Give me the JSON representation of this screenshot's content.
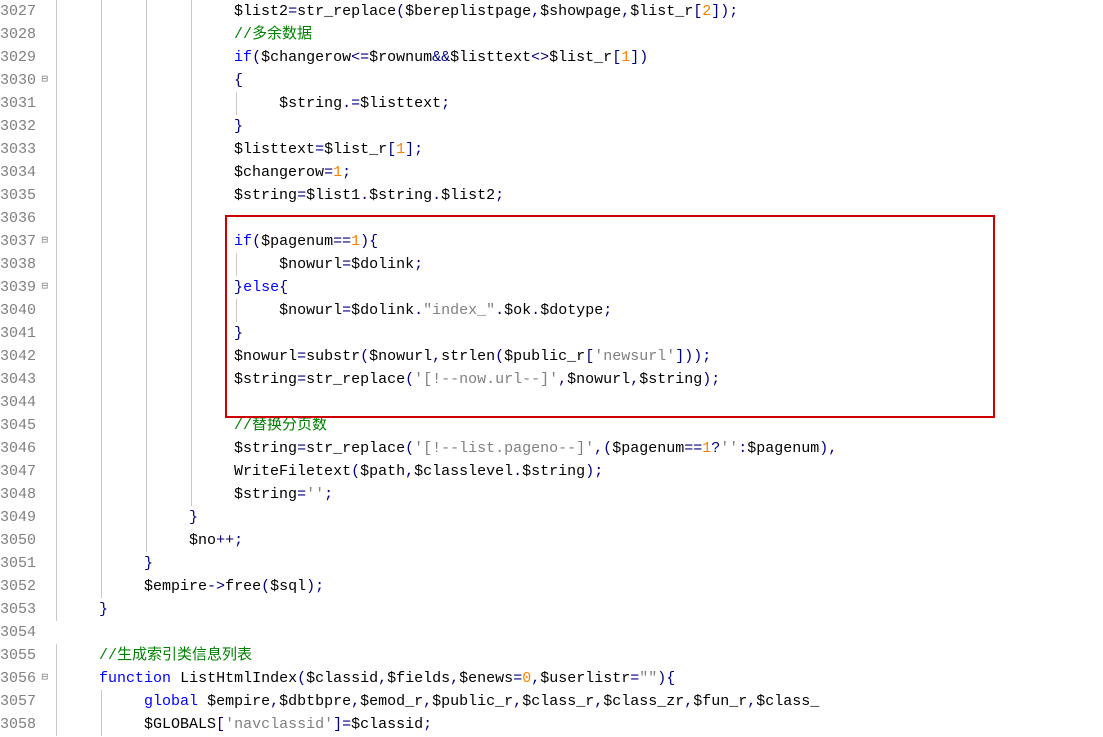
{
  "lines": [
    {
      "num": "3027",
      "fold": "",
      "indent": 4,
      "tokens": [
        {
          "t": "v",
          "v": "$list2"
        },
        {
          "t": "o",
          "v": "="
        },
        {
          "t": "fc",
          "v": "str_replace"
        },
        {
          "t": "p",
          "v": "("
        },
        {
          "t": "v",
          "v": "$bereplistpage"
        },
        {
          "t": "p",
          "v": ","
        },
        {
          "t": "v",
          "v": "$showpage"
        },
        {
          "t": "p",
          "v": ","
        },
        {
          "t": "v",
          "v": "$list_r"
        },
        {
          "t": "br",
          "v": "["
        },
        {
          "t": "n",
          "v": "2"
        },
        {
          "t": "br",
          "v": "]"
        },
        {
          "t": "p",
          "v": ")"
        },
        {
          "t": "s",
          "v": ";"
        }
      ]
    },
    {
      "num": "3028",
      "fold": "",
      "indent": 4,
      "tokens": [
        {
          "t": "c",
          "v": "//多余数据"
        }
      ]
    },
    {
      "num": "3029",
      "fold": "",
      "indent": 4,
      "tokens": [
        {
          "t": "k",
          "v": "if"
        },
        {
          "t": "p",
          "v": "("
        },
        {
          "t": "v",
          "v": "$changerow"
        },
        {
          "t": "o",
          "v": "<="
        },
        {
          "t": "v",
          "v": "$rownum"
        },
        {
          "t": "o",
          "v": "&&"
        },
        {
          "t": "v",
          "v": "$listtext"
        },
        {
          "t": "o",
          "v": "<>"
        },
        {
          "t": "v",
          "v": "$list_r"
        },
        {
          "t": "br",
          "v": "["
        },
        {
          "t": "n",
          "v": "1"
        },
        {
          "t": "br",
          "v": "]"
        },
        {
          "t": "p",
          "v": ")"
        }
      ]
    },
    {
      "num": "3030",
      "fold": "⊟",
      "indent": 4,
      "tokens": [
        {
          "t": "b",
          "v": "{"
        }
      ]
    },
    {
      "num": "3031",
      "fold": "",
      "indent": 5,
      "tokens": [
        {
          "t": "v",
          "v": "$string"
        },
        {
          "t": "o",
          "v": ".="
        },
        {
          "t": "v",
          "v": "$listtext"
        },
        {
          "t": "s",
          "v": ";"
        }
      ]
    },
    {
      "num": "3032",
      "fold": "",
      "indent": 4,
      "tokens": [
        {
          "t": "b",
          "v": "}"
        }
      ]
    },
    {
      "num": "3033",
      "fold": "",
      "indent": 4,
      "tokens": [
        {
          "t": "v",
          "v": "$listtext"
        },
        {
          "t": "o",
          "v": "="
        },
        {
          "t": "v",
          "v": "$list_r"
        },
        {
          "t": "br",
          "v": "["
        },
        {
          "t": "n",
          "v": "1"
        },
        {
          "t": "br",
          "v": "]"
        },
        {
          "t": "s",
          "v": ";"
        }
      ]
    },
    {
      "num": "3034",
      "fold": "",
      "indent": 4,
      "tokens": [
        {
          "t": "v",
          "v": "$changerow"
        },
        {
          "t": "o",
          "v": "="
        },
        {
          "t": "n",
          "v": "1"
        },
        {
          "t": "s",
          "v": ";"
        }
      ]
    },
    {
      "num": "3035",
      "fold": "",
      "indent": 4,
      "tokens": [
        {
          "t": "v",
          "v": "$string"
        },
        {
          "t": "o",
          "v": "="
        },
        {
          "t": "v",
          "v": "$list1"
        },
        {
          "t": "d",
          "v": "."
        },
        {
          "t": "v",
          "v": "$string"
        },
        {
          "t": "d",
          "v": "."
        },
        {
          "t": "v",
          "v": "$list2"
        },
        {
          "t": "s",
          "v": ";"
        }
      ]
    },
    {
      "num": "3036",
      "fold": "",
      "indent": 4,
      "tokens": []
    },
    {
      "num": "3037",
      "fold": "⊟",
      "indent": 4,
      "tokens": [
        {
          "t": "k",
          "v": "if"
        },
        {
          "t": "p",
          "v": "("
        },
        {
          "t": "v",
          "v": "$pagenum"
        },
        {
          "t": "o",
          "v": "=="
        },
        {
          "t": "n",
          "v": "1"
        },
        {
          "t": "p",
          "v": ")"
        },
        {
          "t": "b",
          "v": "{"
        }
      ]
    },
    {
      "num": "3038",
      "fold": "",
      "indent": 5,
      "tokens": [
        {
          "t": "v",
          "v": "$nowurl"
        },
        {
          "t": "o",
          "v": "="
        },
        {
          "t": "v",
          "v": "$dolink"
        },
        {
          "t": "s",
          "v": ";"
        }
      ]
    },
    {
      "num": "3039",
      "fold": "⊟",
      "indent": 4,
      "tokens": [
        {
          "t": "b",
          "v": "}"
        },
        {
          "t": "k",
          "v": "else"
        },
        {
          "t": "b",
          "v": "{"
        }
      ]
    },
    {
      "num": "3040",
      "fold": "",
      "indent": 5,
      "tokens": [
        {
          "t": "v",
          "v": "$nowurl"
        },
        {
          "t": "o",
          "v": "="
        },
        {
          "t": "v",
          "v": "$dolink"
        },
        {
          "t": "d",
          "v": "."
        },
        {
          "t": "st",
          "v": "\"index_\""
        },
        {
          "t": "d",
          "v": "."
        },
        {
          "t": "v",
          "v": "$ok"
        },
        {
          "t": "d",
          "v": "."
        },
        {
          "t": "v",
          "v": "$dotype"
        },
        {
          "t": "s",
          "v": ";"
        }
      ]
    },
    {
      "num": "3041",
      "fold": "",
      "indent": 4,
      "tokens": [
        {
          "t": "b",
          "v": "}"
        }
      ]
    },
    {
      "num": "3042",
      "fold": "",
      "indent": 4,
      "tokens": [
        {
          "t": "v",
          "v": "$nowurl"
        },
        {
          "t": "o",
          "v": "="
        },
        {
          "t": "fc",
          "v": "substr"
        },
        {
          "t": "p",
          "v": "("
        },
        {
          "t": "v",
          "v": "$nowurl"
        },
        {
          "t": "p",
          "v": ","
        },
        {
          "t": "fc",
          "v": "strlen"
        },
        {
          "t": "p",
          "v": "("
        },
        {
          "t": "v",
          "v": "$public_r"
        },
        {
          "t": "br",
          "v": "["
        },
        {
          "t": "st",
          "v": "'newsurl'"
        },
        {
          "t": "br",
          "v": "]"
        },
        {
          "t": "p",
          "v": ")"
        },
        {
          "t": "p",
          "v": ")"
        },
        {
          "t": "s",
          "v": ";"
        }
      ]
    },
    {
      "num": "3043",
      "fold": "",
      "indent": 4,
      "tokens": [
        {
          "t": "v",
          "v": "$string"
        },
        {
          "t": "o",
          "v": "="
        },
        {
          "t": "fc",
          "v": "str_replace"
        },
        {
          "t": "p",
          "v": "("
        },
        {
          "t": "st",
          "v": "'[!--now.url--]'"
        },
        {
          "t": "p",
          "v": ","
        },
        {
          "t": "v",
          "v": "$nowurl"
        },
        {
          "t": "p",
          "v": ","
        },
        {
          "t": "v",
          "v": "$string"
        },
        {
          "t": "p",
          "v": ")"
        },
        {
          "t": "s",
          "v": ";"
        }
      ]
    },
    {
      "num": "3044",
      "fold": "",
      "indent": 4,
      "tokens": []
    },
    {
      "num": "3045",
      "fold": "",
      "indent": 4,
      "tokens": [
        {
          "t": "c",
          "v": "//替换分页数"
        }
      ]
    },
    {
      "num": "3046",
      "fold": "",
      "indent": 4,
      "tokens": [
        {
          "t": "v",
          "v": "$string"
        },
        {
          "t": "o",
          "v": "="
        },
        {
          "t": "fc",
          "v": "str_replace"
        },
        {
          "t": "p",
          "v": "("
        },
        {
          "t": "st",
          "v": "'[!--list.pageno--]'"
        },
        {
          "t": "p",
          "v": ","
        },
        {
          "t": "p",
          "v": "("
        },
        {
          "t": "v",
          "v": "$pagenum"
        },
        {
          "t": "o",
          "v": "=="
        },
        {
          "t": "n",
          "v": "1"
        },
        {
          "t": "o",
          "v": "?"
        },
        {
          "t": "st",
          "v": "''"
        },
        {
          "t": "o",
          "v": ":"
        },
        {
          "t": "v",
          "v": "$pagenum"
        },
        {
          "t": "p",
          "v": ")"
        },
        {
          "t": "p",
          "v": ","
        }
      ]
    },
    {
      "num": "3047",
      "fold": "",
      "indent": 4,
      "tokens": [
        {
          "t": "fc",
          "v": "WriteFiletext"
        },
        {
          "t": "p",
          "v": "("
        },
        {
          "t": "v",
          "v": "$path"
        },
        {
          "t": "p",
          "v": ","
        },
        {
          "t": "v",
          "v": "$classlevel"
        },
        {
          "t": "d",
          "v": "."
        },
        {
          "t": "v",
          "v": "$string"
        },
        {
          "t": "p",
          "v": ")"
        },
        {
          "t": "s",
          "v": ";"
        }
      ]
    },
    {
      "num": "3048",
      "fold": "",
      "indent": 4,
      "tokens": [
        {
          "t": "v",
          "v": "$string"
        },
        {
          "t": "o",
          "v": "="
        },
        {
          "t": "st",
          "v": "''"
        },
        {
          "t": "s",
          "v": ";"
        }
      ]
    },
    {
      "num": "3049",
      "fold": "",
      "indent": 3,
      "tokens": [
        {
          "t": "b",
          "v": "}"
        }
      ]
    },
    {
      "num": "3050",
      "fold": "",
      "indent": 3,
      "tokens": [
        {
          "t": "v",
          "v": "$no"
        },
        {
          "t": "o",
          "v": "++"
        },
        {
          "t": "s",
          "v": ";"
        }
      ]
    },
    {
      "num": "3051",
      "fold": "",
      "indent": 2,
      "tokens": [
        {
          "t": "b",
          "v": "}"
        }
      ]
    },
    {
      "num": "3052",
      "fold": "",
      "indent": 2,
      "tokens": [
        {
          "t": "v",
          "v": "$empire"
        },
        {
          "t": "a",
          "v": "->"
        },
        {
          "t": "fc",
          "v": "free"
        },
        {
          "t": "p",
          "v": "("
        },
        {
          "t": "v",
          "v": "$sql"
        },
        {
          "t": "p",
          "v": ")"
        },
        {
          "t": "s",
          "v": ";"
        }
      ]
    },
    {
      "num": "3053",
      "fold": "",
      "indent": 1,
      "tokens": [
        {
          "t": "b",
          "v": "}"
        }
      ]
    },
    {
      "num": "3054",
      "fold": "",
      "indent": 0,
      "tokens": []
    },
    {
      "num": "3055",
      "fold": "",
      "indent": 1,
      "tokens": [
        {
          "t": "c",
          "v": "//生成索引类信息列表"
        }
      ]
    },
    {
      "num": "3056",
      "fold": "⊟",
      "indent": 1,
      "tokens": [
        {
          "t": "k",
          "v": "function"
        },
        {
          "t": "sp",
          "v": " "
        },
        {
          "t": "fc",
          "v": "ListHtmlIndex"
        },
        {
          "t": "p",
          "v": "("
        },
        {
          "t": "v",
          "v": "$classid"
        },
        {
          "t": "p",
          "v": ","
        },
        {
          "t": "v",
          "v": "$fields"
        },
        {
          "t": "p",
          "v": ","
        },
        {
          "t": "v",
          "v": "$enews"
        },
        {
          "t": "o",
          "v": "="
        },
        {
          "t": "n",
          "v": "0"
        },
        {
          "t": "p",
          "v": ","
        },
        {
          "t": "v",
          "v": "$userlistr"
        },
        {
          "t": "o",
          "v": "="
        },
        {
          "t": "st",
          "v": "\"\""
        },
        {
          "t": "p",
          "v": ")"
        },
        {
          "t": "b",
          "v": "{"
        }
      ]
    },
    {
      "num": "3057",
      "fold": "",
      "indent": 2,
      "tokens": [
        {
          "t": "k",
          "v": "global"
        },
        {
          "t": "sp",
          "v": " "
        },
        {
          "t": "v",
          "v": "$empire"
        },
        {
          "t": "p",
          "v": ","
        },
        {
          "t": "v",
          "v": "$dbtbpre"
        },
        {
          "t": "p",
          "v": ","
        },
        {
          "t": "v",
          "v": "$emod_r"
        },
        {
          "t": "p",
          "v": ","
        },
        {
          "t": "v",
          "v": "$public_r"
        },
        {
          "t": "p",
          "v": ","
        },
        {
          "t": "v",
          "v": "$class_r"
        },
        {
          "t": "p",
          "v": ","
        },
        {
          "t": "v",
          "v": "$class_zr"
        },
        {
          "t": "p",
          "v": ","
        },
        {
          "t": "v",
          "v": "$fun_r"
        },
        {
          "t": "p",
          "v": ","
        },
        {
          "t": "v",
          "v": "$class_"
        }
      ]
    },
    {
      "num": "3058",
      "fold": "",
      "indent": 2,
      "tokens": [
        {
          "t": "v",
          "v": "$GLOBALS"
        },
        {
          "t": "br",
          "v": "["
        },
        {
          "t": "st",
          "v": "'navclassid'"
        },
        {
          "t": "br",
          "v": "]"
        },
        {
          "t": "o",
          "v": "="
        },
        {
          "t": "v",
          "v": "$classid"
        },
        {
          "t": "s",
          "v": ";"
        }
      ]
    }
  ],
  "highlight": {
    "startLine": 3036,
    "endLine": 3044
  }
}
